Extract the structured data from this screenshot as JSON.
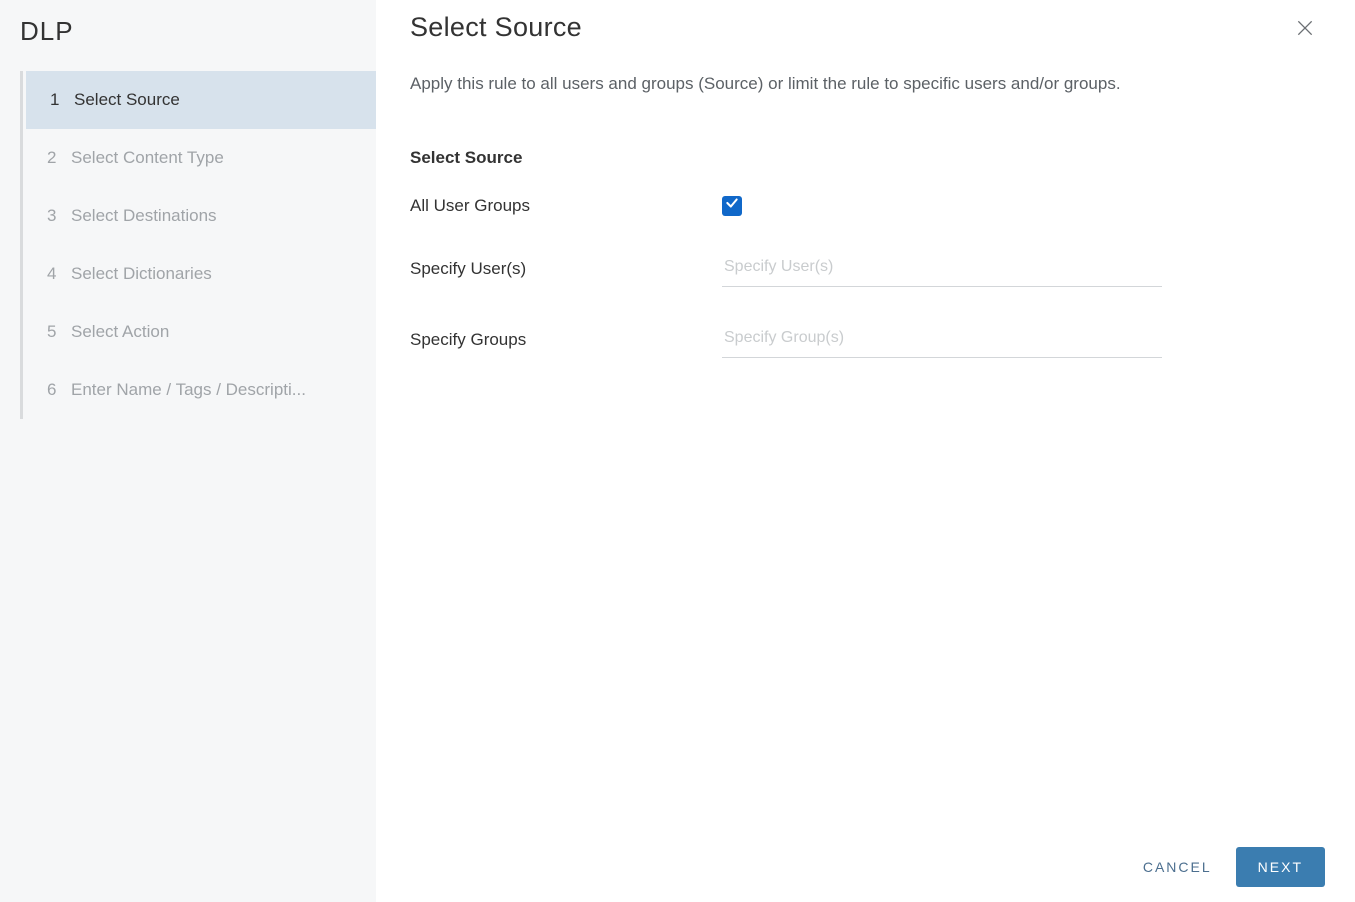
{
  "sidebar": {
    "title": "DLP",
    "steps": [
      {
        "num": "1",
        "label": "Select Source",
        "active": true
      },
      {
        "num": "2",
        "label": "Select Content Type",
        "active": false
      },
      {
        "num": "3",
        "label": "Select Destinations",
        "active": false
      },
      {
        "num": "4",
        "label": "Select Dictionaries",
        "active": false
      },
      {
        "num": "5",
        "label": "Select Action",
        "active": false
      },
      {
        "num": "6",
        "label": "Enter Name / Tags / Descripti...",
        "active": false
      }
    ]
  },
  "header": {
    "title": "Select Source",
    "description": "Apply this rule to all users and groups (Source) or limit the rule to specific users and/or groups."
  },
  "form": {
    "section_title": "Select Source",
    "all_user_groups_label": "All User Groups",
    "all_user_groups_checked": true,
    "specify_users_label": "Specify User(s)",
    "specify_users_placeholder": "Specify User(s)",
    "specify_groups_label": "Specify Groups",
    "specify_groups_placeholder": "Specify Group(s)"
  },
  "footer": {
    "cancel_label": "CANCEL",
    "next_label": "NEXT"
  }
}
